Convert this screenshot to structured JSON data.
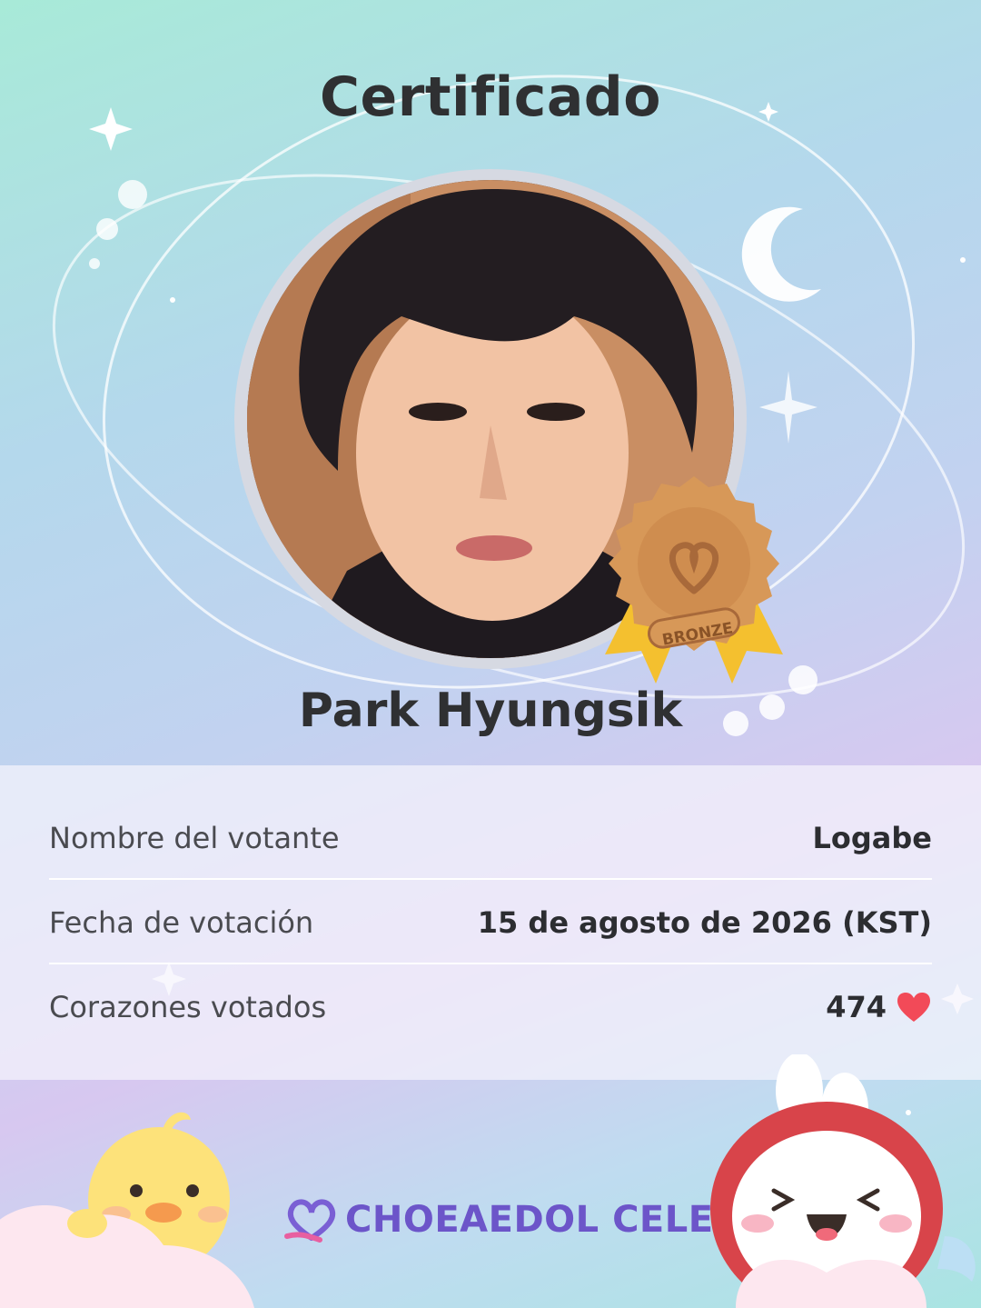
{
  "certificate": {
    "title": "Certificado",
    "celebrity_name": "Park Hyungsik",
    "medal": {
      "label": "BRONZE",
      "color": "#d79858"
    }
  },
  "details": {
    "rows": [
      {
        "label": "Nombre del votante",
        "value": "Logabe"
      },
      {
        "label": "Fecha de votación",
        "value": "15 de agosto de 2026 (KST)"
      },
      {
        "label": "Corazones votados",
        "value": "474",
        "icon": "heart-icon"
      }
    ]
  },
  "brand": {
    "name": "CHOEAEDOL CELEB",
    "icon": "heart-loop-logo-icon",
    "color": "#6c55c9"
  },
  "colors": {
    "heart": "#f24a58",
    "text_dark": "#2f3032",
    "panel": "#f5f4fc"
  }
}
